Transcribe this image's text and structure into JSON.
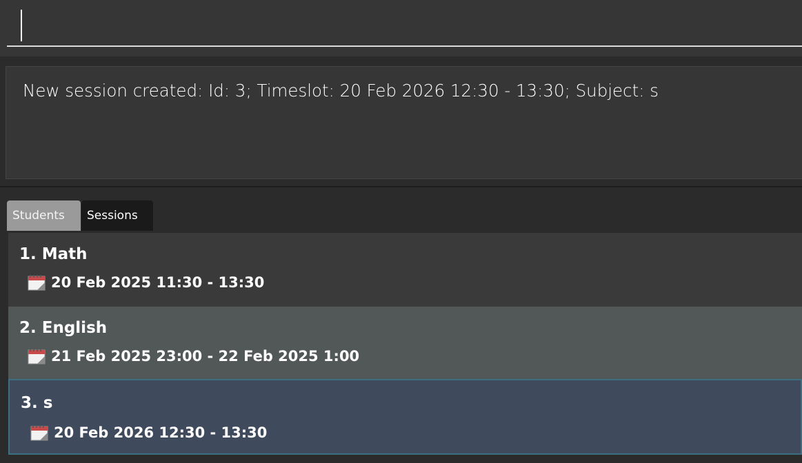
{
  "command_box": {
    "value": "",
    "placeholder": ""
  },
  "result": {
    "message": "New session created: Id: 3; Timeslot: 20 Feb 2026 12:30 - 13:30; Subject: s"
  },
  "tabs": [
    {
      "label": "Students",
      "selected": false
    },
    {
      "label": "Sessions",
      "selected": true
    }
  ],
  "sessions": [
    {
      "title": "1. Math",
      "time": "20 Feb 2025 11:30 - 13:30",
      "icon": "calendar-icon"
    },
    {
      "title": "2. English",
      "time": "21 Feb 2025 23:00 - 22 Feb 2025 1:00",
      "icon": "calendar-icon"
    },
    {
      "title": "3. s",
      "time": "20 Feb 2026 12:30 - 13:30",
      "icon": "calendar-icon"
    }
  ],
  "colors": {
    "background": "#2b2b2b",
    "panel": "#363636",
    "selected_item": "#3f4a5d",
    "selected_border": "#3d6f82",
    "hover_item": "#525757"
  }
}
